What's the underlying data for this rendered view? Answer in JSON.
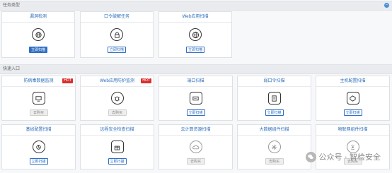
{
  "sections": {
    "scan_types": "任务类型",
    "quick_entry": "快速入口"
  },
  "top_cards": [
    {
      "title": "漏洞检测",
      "button": "立即扫描",
      "icon": "globe-shield-icon"
    },
    {
      "title": "口令破解任务",
      "button": "立即扫描",
      "icon": "lock-icon"
    },
    {
      "title": "Web应用扫描",
      "button": "立即扫描",
      "icon": "globe-icon"
    }
  ],
  "row1_cards": [
    {
      "title": "防病毒数据监测",
      "button": "去购买",
      "hot": "HOT",
      "icon": "shield-monitor-icon"
    },
    {
      "title": "Web应用防护监测",
      "button": "去购买",
      "hot": "HOT",
      "icon": "bug-icon"
    },
    {
      "title": "端口扫描",
      "button": "立即扫描",
      "icon": "port-icon"
    },
    {
      "title": "弱口令扫描",
      "button": "立即扫描",
      "icon": "password-doc-icon"
    },
    {
      "title": "主机配置扫描",
      "button": "立即扫描",
      "icon": "host-config-icon"
    }
  ],
  "row2_cards": [
    {
      "title": "基线配置扫描",
      "button": "立即扫描",
      "icon": "baseline-icon"
    },
    {
      "title": "远程安全检查扫描",
      "button": "立即扫描",
      "icon": "gift-box-icon"
    },
    {
      "title": "云计算资源扫描",
      "button": "去购买",
      "icon": "cloud-icon"
    },
    {
      "title": "大数据组件扫描",
      "button": "去购买",
      "icon": "big-data-icon"
    },
    {
      "title": "物联网组件扫描",
      "button": "去购买",
      "icon": "iot-icon"
    }
  ],
  "watermark": {
    "text": "公众号 · 智检安全"
  },
  "colors": {
    "accent": "#2f6fc4",
    "hot": "#d9302c",
    "title": "#2a6db8"
  }
}
